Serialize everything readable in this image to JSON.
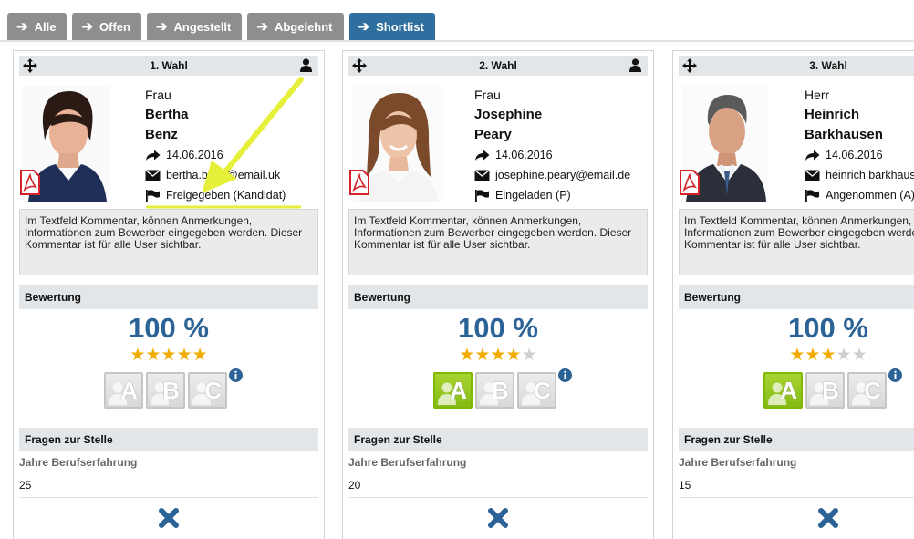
{
  "tabs": [
    {
      "label": "Alle",
      "active": false
    },
    {
      "label": "Offen",
      "active": false
    },
    {
      "label": "Angestellt",
      "active": false
    },
    {
      "label": "Abgelehnt",
      "active": false
    },
    {
      "label": "Shortlist",
      "active": true
    }
  ],
  "colors": {
    "tab_inactive": "#8e8e8e",
    "tab_active": "#2f6f9f",
    "percent_text": "#2c6396",
    "star_on": "#f2ac00",
    "abc_selected": "#85bb14",
    "annotation_arrow": "#e6f03a"
  },
  "section_labels": {
    "rating": "Bewertung",
    "questions": "Fragen zur Stelle",
    "experience": "Jahre Berufserfahrung"
  },
  "icons": {
    "move": "move-arrows-icon",
    "person": "person-icon",
    "pdf": "pdf-file-icon",
    "date": "forward-arrow-icon",
    "email": "envelope-icon",
    "status": "flag-icon",
    "info": "info-circle-icon",
    "remove": "close-x-icon"
  },
  "cards": [
    {
      "rank": "1. Wahl",
      "salutation": "Frau",
      "first_name": "Bertha",
      "last_name": "Benz",
      "date": "14.06.2016",
      "email": "bertha.benz@email.uk",
      "status": "Freigegeben (Kandidat)",
      "comment": "Im Textfeld Kommentar, können Anmerkungen, Informationen zum Bewerber eingegeben werden. Dieser Kommentar ist für alle User sichtbar.",
      "percent": "100 %",
      "stars": 5,
      "abc_selected": "",
      "abc": [
        "A",
        "B",
        "C"
      ],
      "experience_years": "25"
    },
    {
      "rank": "2. Wahl",
      "salutation": "Frau",
      "first_name": "Josephine",
      "last_name": "Peary",
      "date": "14.06.2016",
      "email": "josephine.peary@email.de",
      "status": "Eingeladen (P)",
      "comment": "Im Textfeld Kommentar, können Anmerkungen, Informationen zum Bewerber eingegeben werden. Dieser Kommentar ist für alle User sichtbar.",
      "percent": "100 %",
      "stars": 4,
      "abc_selected": "A",
      "abc": [
        "A",
        "B",
        "C"
      ],
      "experience_years": "20"
    },
    {
      "rank": "3. Wahl",
      "salutation": "Herr",
      "first_name": "Heinrich",
      "last_name": "Barkhausen",
      "date": "14.06.2016",
      "email": "heinrich.barkhausen@email.de",
      "status": "Angenommen (A)",
      "comment": "Im Textfeld Kommentar, können Anmerkungen, Informationen zum Bewerber eingegeben werden. Dieser Kommentar ist für alle User sichtbar.",
      "percent": "100 %",
      "stars": 3,
      "abc_selected": "A",
      "abc": [
        "A",
        "B",
        "C"
      ],
      "experience_years": "15"
    }
  ]
}
